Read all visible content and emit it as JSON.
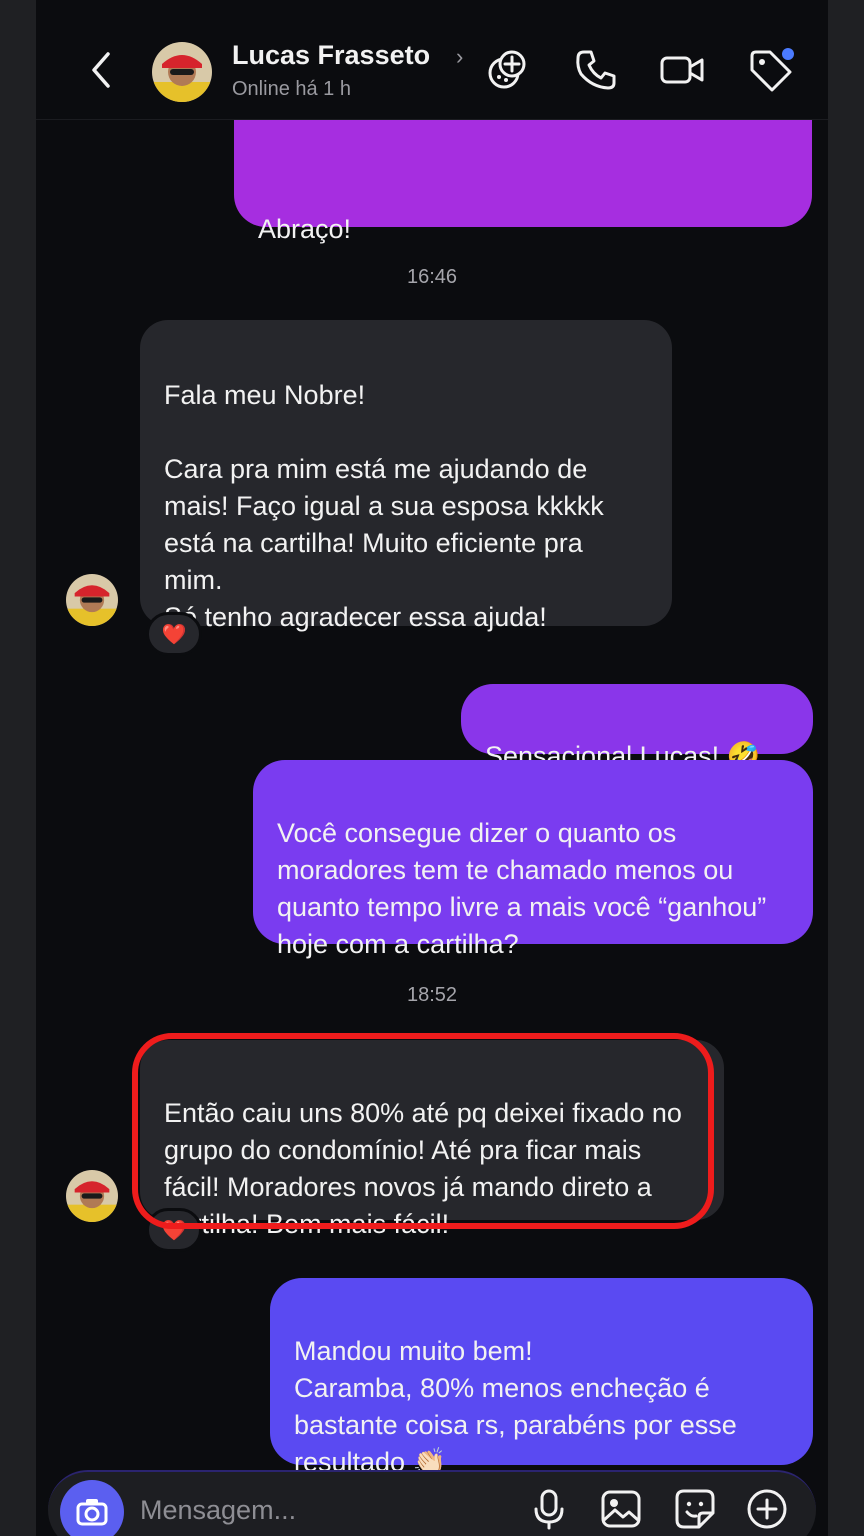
{
  "header": {
    "contact_name": "Lucas Frasseto",
    "status": "Online há 1 h"
  },
  "messages": {
    "m1": {
      "text": "Abraço!",
      "direction": "out"
    },
    "t1": "16:46",
    "m2": {
      "text": "Fala meu Nobre!\n\nCara pra mim está me ajudando de mais! Faço igual a sua esposa kkkkk está na cartilha! Muito eficiente pra mim.\nSó tenho agradecer essa ajuda!",
      "direction": "in",
      "reaction": "❤️"
    },
    "m3": {
      "text": "Sensacional Lucas! 🤣",
      "direction": "out"
    },
    "m4": {
      "text": "Você consegue dizer o quanto os moradores tem te chamado menos ou quanto tempo livre a mais você “ganhou” hoje com a cartilha?",
      "direction": "out"
    },
    "t2": "18:52",
    "m5": {
      "text": "Então caiu uns 80% até pq deixei fixado no grupo do condomínio! Até pra ficar mais fácil! Moradores novos já mando direto a cartilha! Bem mais fácil!",
      "direction": "in",
      "reaction": "❤️"
    },
    "m6": {
      "text": "Mandou muito bem!\nCaramba, 80% menos encheção é bastante coisa rs, parabéns por esse resultado 👏🏻",
      "direction": "out"
    }
  },
  "composer": {
    "placeholder": "Mensagem..."
  },
  "colors": {
    "background": "#0b0c0f",
    "incoming_bubble": "#26272c",
    "outgoing_magenta": "#a62ee0",
    "outgoing_violet": "#7a3cf0",
    "outgoing_indigo": "#5a4af2",
    "highlight": "#ee1c1c",
    "notification_dot": "#4b7bff"
  },
  "icons": [
    "back-chevron-icon",
    "avatar",
    "chevron-right-icon",
    "effects-icon",
    "phone-icon",
    "video-icon",
    "tag-icon",
    "camera-icon",
    "microphone-icon",
    "gallery-icon",
    "sticker-icon",
    "plus-icon"
  ]
}
